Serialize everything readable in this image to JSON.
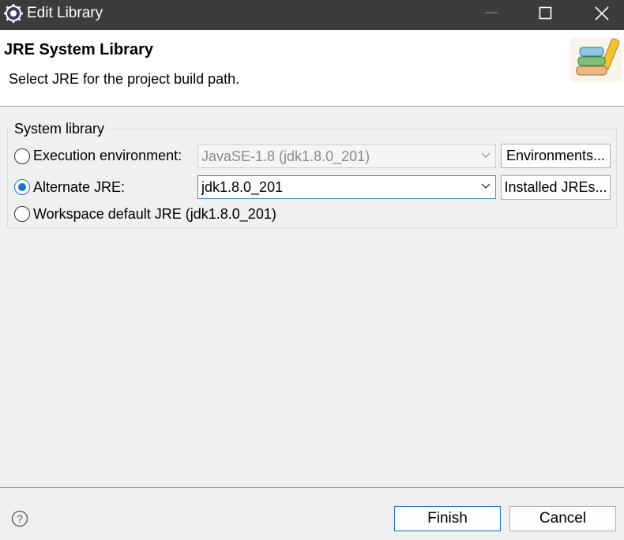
{
  "window": {
    "title": "Edit Library",
    "icons": {
      "app": "eclipse-gear-icon",
      "minimize": "minimize-icon",
      "maximize": "maximize-icon",
      "close": "close-icon"
    }
  },
  "header": {
    "title": "JRE System Library",
    "description": "Select JRE for the project build path.",
    "banner_icon": "library-books-icon"
  },
  "system_library": {
    "group_label": "System library",
    "options": [
      {
        "label": "Execution environment:",
        "selected": false,
        "combo_value": "JavaSE-1.8 (jdk1.8.0_201)",
        "combo_enabled": false,
        "button": "Environments..."
      },
      {
        "label": "Alternate JRE:",
        "selected": true,
        "combo_value": "jdk1.8.0_201",
        "combo_enabled": true,
        "button": "Installed JREs..."
      },
      {
        "label": "Workspace default JRE (jdk1.8.0_201)",
        "selected": false
      }
    ]
  },
  "footer": {
    "help_icon": "help-icon",
    "finish_label": "Finish",
    "cancel_label": "Cancel"
  },
  "colors": {
    "titlebar": "#3c3c3c",
    "accent": "#1a73c9",
    "dialog_bg": "#f0f0f0"
  }
}
